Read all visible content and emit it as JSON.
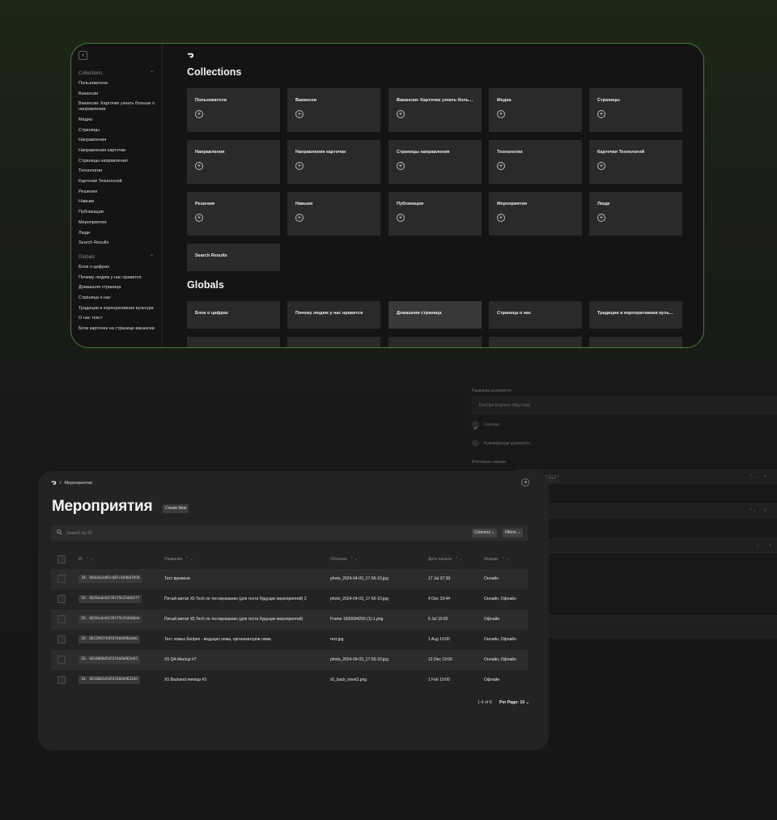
{
  "admin": {
    "sidebar": {
      "collections_label": "Collections",
      "collections": [
        "Пользователи",
        "Вакансии",
        "Вакансии: Карточки узнать больше о направлении",
        "Медиа",
        "Страницы",
        "Направления",
        "Направления карточки",
        "Страницы направления",
        "Технологии",
        "Карточки Технологий",
        "Решения",
        "Навыки",
        "Публикации",
        "Мероприятия",
        "Люди",
        "Search Results"
      ],
      "globals_label": "Globals",
      "globals": [
        "Блок о цифрах",
        "Почему людям у нас нравится",
        "Домашняя страница",
        "Страница о нас",
        "Традиции и корпоративная культура",
        "О нас текст",
        "Блок карточек на странице вакансии"
      ]
    },
    "collections_title": "Collections",
    "collection_cards": [
      "Пользователи",
      "Вакансии",
      "Вакансии: Карточки узнать больше о направлении",
      "Медиа",
      "Страницы",
      "Направления",
      "Направления карточки",
      "Страницы направления",
      "Технологии",
      "Карточки Технологий",
      "Решения",
      "Навыки",
      "Публикации",
      "Мероприятия",
      "Люди",
      "Search Results"
    ],
    "globals_title": "Globals",
    "global_cards": [
      "Блок о цифрах",
      "Почему людям у нас нравится",
      "Домашняя страница",
      "Страница о нас",
      "Традиции и корпоративная культура"
    ]
  },
  "ghost_form": {
    "position_label": "Название должности",
    "position_value": "DevOps Engineer (Big Data)",
    "hot_label": "Горячая",
    "lead_label": "Руководящая должность",
    "skills_label": "Ключевые навыки",
    "skill_tag": "Linux"
  },
  "events": {
    "breadcrumb_sep": "/",
    "breadcrumb": "Мероприятия",
    "title": "Мероприятия",
    "create_label": "Create New",
    "search_placeholder": "Search by ID",
    "columns_label": "Columns",
    "filters_label": "Filters",
    "headers": {
      "id": "ID",
      "name": "Название",
      "cover": "Обложка",
      "start": "Дата начала",
      "format": "Формат"
    },
    "rows": [
      {
        "id": "ID: 660e6a2d92c407c469b07058",
        "name": "Тест времени",
        "cover": "photo_2024-04-03_17-56-10.jpg",
        "start": "17 Jul 07:30",
        "format": "Онлайн"
      },
      {
        "id": "ID: 6628eab4d1702f5b354b82f7",
        "name": "Пятый митап X5 Tech по тестированию (для теста будущих мероприятий) 2",
        "cover": "photo_2024-04-03_17-56-10.jpg",
        "start": "4 Dec 19:44",
        "format": "Онлайн, Офлайн"
      },
      {
        "id": "ID: 6628eab4d1702f5b354b0deb",
        "name": "Пятый митап X5 Tech по тестированию (для теста будущих мероприятий)",
        "cover": "Frame 1000004250 (1)-1.png",
        "start": "6 Jul 19:00",
        "format": "Офлайн"
      },
      {
        "id": "ID: 6613992f6d5354b6b96adab",
        "name": "Тест новых багфич - ведущих нема, организаторов нема",
        "cover": "rect.jpg",
        "start": "1 Aug 19:00",
        "format": "Онлайн, Офлайн"
      },
      {
        "id": "ID: 6610090d5d5354b6b963dd3",
        "name": "X5 QA Meetup #7",
        "cover": "photo_2024-04-03_17-56-10.jpg",
        "start": "12 Dec 19:00",
        "format": "Онлайн, Офлайн"
      },
      {
        "id": "ID: 6610002e5d5354b6b9632dd",
        "name": "X5 Backend meetup #3",
        "cover": "x5_back_meet3.png",
        "start": "1 Feb 19:00",
        "format": "Офлайн"
      }
    ],
    "pagination": "1-6 of 6",
    "per_page": "Per Page: 10"
  }
}
